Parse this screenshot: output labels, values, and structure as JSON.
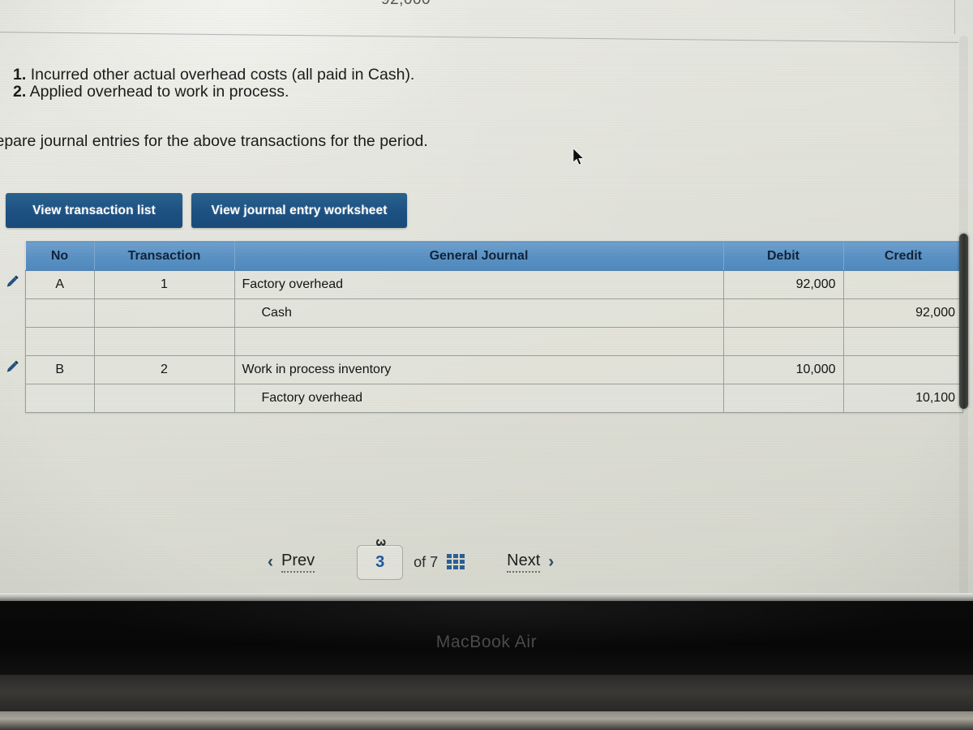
{
  "device": {
    "bezel_label": "MacBook Air"
  },
  "cut_off_panel": {
    "partial_number": "92,000"
  },
  "instructions": {
    "item_1_num": "1.",
    "item_1_text": "Incurred other actual overhead costs (all paid in Cash).",
    "item_2_num": "2.",
    "item_2_text": "Applied overhead to work in process.",
    "prompt": "repare journal entries for the above transactions for the period."
  },
  "toolbar": {
    "view_transaction_list": "View transaction list",
    "view_journal_entry_worksheet": "View journal entry worksheet"
  },
  "table": {
    "headers": {
      "no": "No",
      "transaction": "Transaction",
      "general_journal": "General Journal",
      "debit": "Debit",
      "credit": "Credit"
    },
    "rows": [
      {
        "no": "A",
        "transaction": "1",
        "account": "Factory overhead",
        "indent": false,
        "debit": "92,000",
        "credit": ""
      },
      {
        "no": "",
        "transaction": "",
        "account": "Cash",
        "indent": true,
        "debit": "",
        "credit": "92,000"
      },
      {
        "no": "",
        "transaction": "",
        "account": "",
        "indent": false,
        "debit": "",
        "credit": ""
      },
      {
        "no": "B",
        "transaction": "2",
        "account": "Work in process inventory",
        "indent": false,
        "debit": "10,000",
        "credit": ""
      },
      {
        "no": "",
        "transaction": "",
        "account": "Factory overhead",
        "indent": true,
        "debit": "",
        "credit": "10,100"
      }
    ]
  },
  "pagination": {
    "prev_label": "Prev",
    "prev_chevron": "‹",
    "current_page": "3",
    "page_ghost": "3",
    "of_label": "of 7",
    "grid_icon": "grid-icon",
    "next_label": "Next",
    "next_chevron": "›"
  },
  "colors": {
    "button_blue": "#1d5183",
    "header_blue": "#5b92c4",
    "page_number_blue": "#1d57a0",
    "grid_icon_blue": "#2c5f95"
  }
}
